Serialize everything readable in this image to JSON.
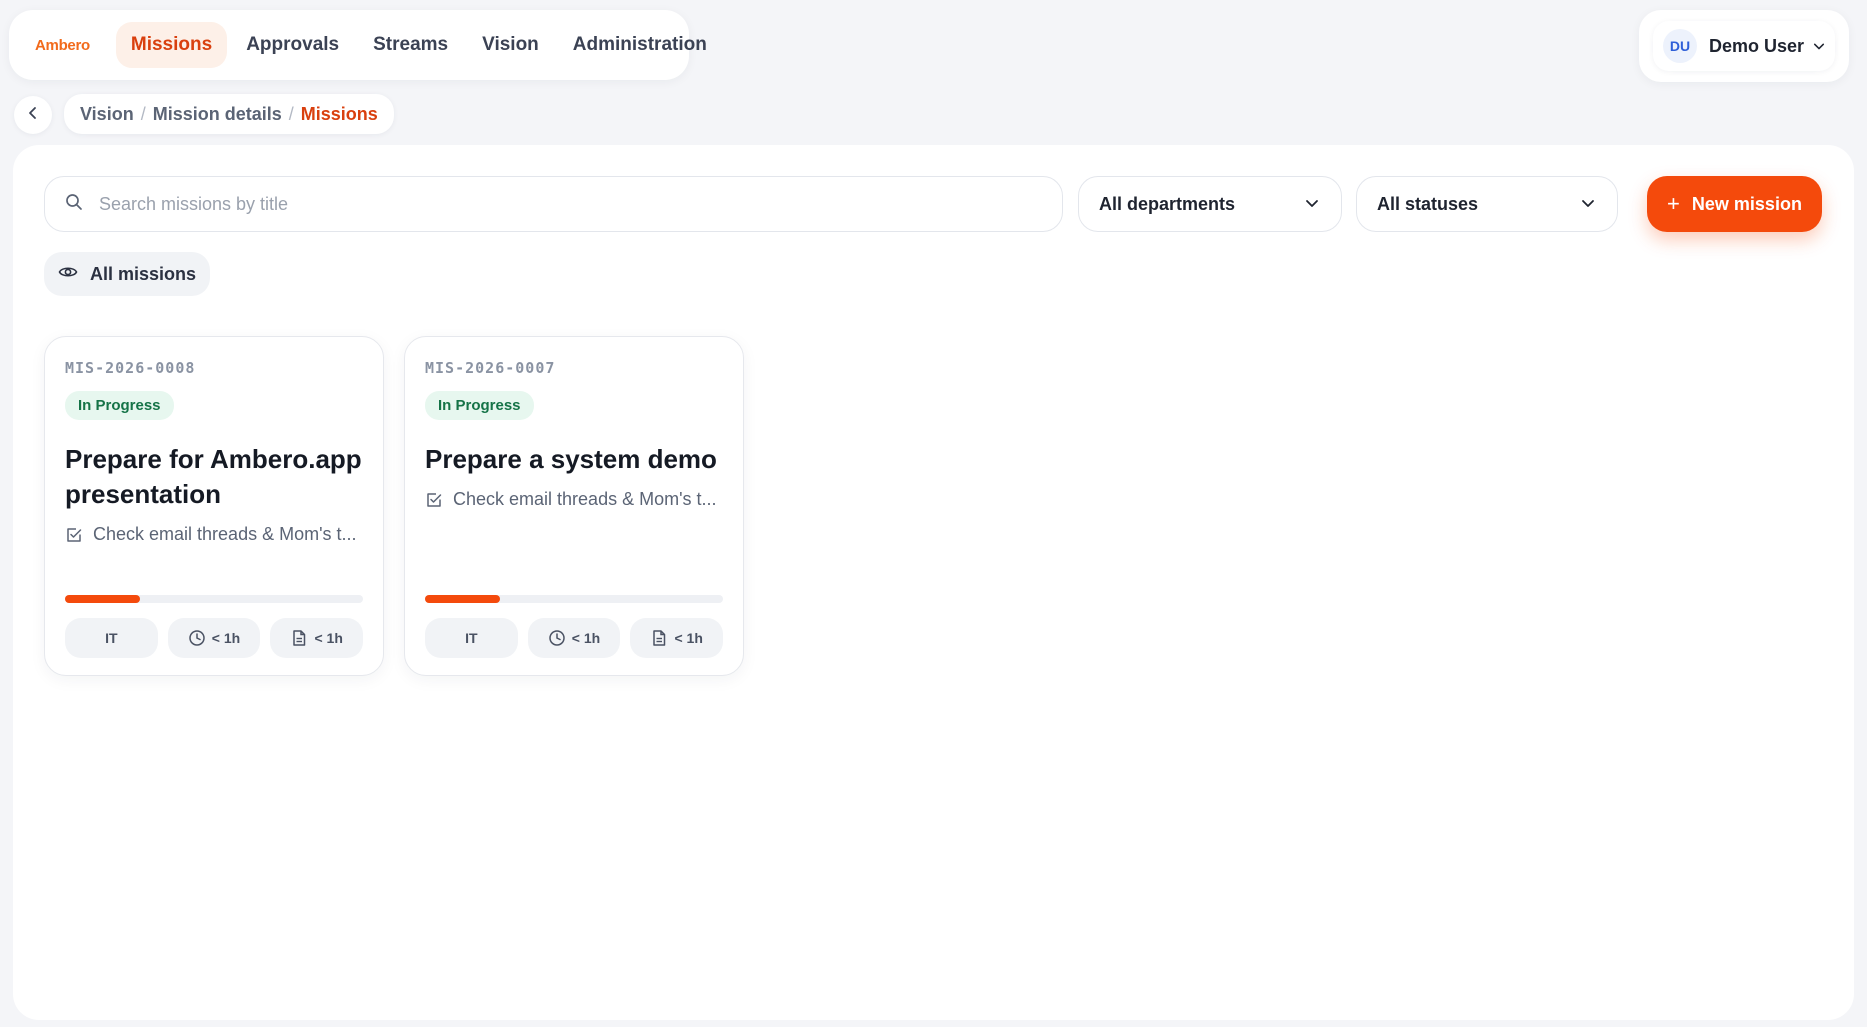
{
  "nav": {
    "logo": "Ambero",
    "items": [
      {
        "label": "Missions",
        "active": true
      },
      {
        "label": "Approvals",
        "active": false
      },
      {
        "label": "Streams",
        "active": false
      },
      {
        "label": "Vision",
        "active": false
      },
      {
        "label": "Administration",
        "active": false
      }
    ]
  },
  "user": {
    "initials": "DU",
    "name": "Demo User"
  },
  "breadcrumb": {
    "items": [
      "Vision",
      "Mission details"
    ],
    "current": "Missions"
  },
  "toolbar": {
    "search_placeholder": "Search missions by title",
    "search_value": "",
    "department_filter": "All departments",
    "status_filter": "All statuses",
    "new_button": "New mission",
    "view_filter": "All missions"
  },
  "missions": [
    {
      "id": "MIS-2026-0008",
      "status": "In Progress",
      "title": "Prepare for Ambero.app presentation",
      "task": "Check email threads & Mom's t...",
      "progress": 0.25,
      "department": "IT",
      "time": "< 1h",
      "docs": "< 1h"
    },
    {
      "id": "MIS-2026-0007",
      "status": "In Progress",
      "title": "Prepare a system demo",
      "task": "Check email threads & Mom's t...",
      "progress": 0.25,
      "department": "IT",
      "time": "< 1h",
      "docs": "< 1h"
    }
  ],
  "colors": {
    "accent": "#f44a0c",
    "active_nav_text": "#d9400f",
    "badge_bg": "#e7f7ef",
    "badge_text": "#157347"
  }
}
